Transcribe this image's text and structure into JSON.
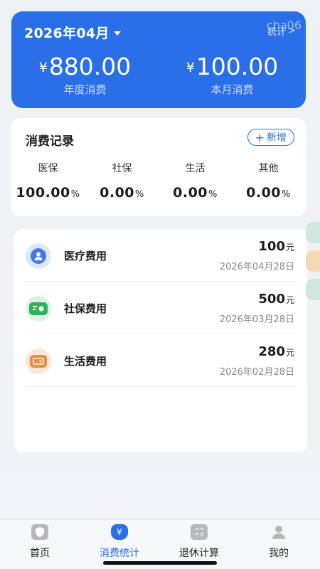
{
  "header": {
    "date": "2026年04月",
    "stat_link": "统计",
    "watermark": "cha06",
    "annual_amount": "880.00",
    "annual_label": "年度消费",
    "monthly_amount": "100.00",
    "monthly_label": "本月消费",
    "currency": "¥",
    "accent_color": "#2a6fe8"
  },
  "records": {
    "title": "消费记录",
    "add_label": "新增",
    "categories": [
      {
        "label": "医保",
        "value": "100.00",
        "unit": "%"
      },
      {
        "label": "社保",
        "value": "0.00",
        "unit": "%"
      },
      {
        "label": "生活",
        "value": "0.00",
        "unit": "%"
      },
      {
        "label": "其他",
        "value": "0.00",
        "unit": "%"
      }
    ]
  },
  "expenses": [
    {
      "name": "医疗费用",
      "amount": "100",
      "unit": "元",
      "date": "2026年04月28日",
      "icon": "medical-person-icon",
      "icon_bg": "#dde8fb",
      "icon_color": "#3f7be6"
    },
    {
      "name": "社保费用",
      "amount": "500",
      "unit": "元",
      "date": "2026年03月28日",
      "icon": "social-insurance-card-icon",
      "icon_bg": "#dcf3e3",
      "icon_color": "#2fb35a"
    },
    {
      "name": "生活费用",
      "amount": "280",
      "unit": "元",
      "date": "2026年02月28日",
      "icon": "living-wallet-icon",
      "icon_bg": "#fde7d6",
      "icon_color": "#f08a3c"
    }
  ],
  "nav": [
    {
      "label": "首页",
      "icon": "shield-home-icon",
      "active": false
    },
    {
      "label": "消费统计",
      "icon": "money-bag-icon",
      "active": true
    },
    {
      "label": "退休计算",
      "icon": "calculator-icon",
      "active": false
    },
    {
      "label": "我的",
      "icon": "user-icon",
      "active": false
    }
  ]
}
